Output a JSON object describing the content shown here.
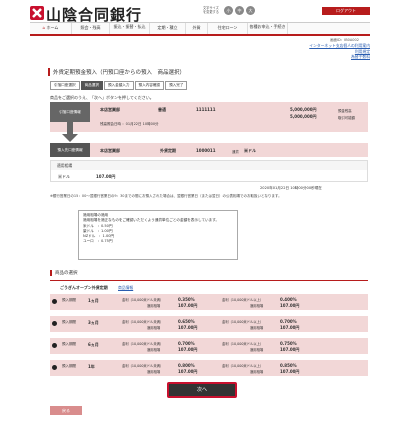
{
  "header": {
    "bank_name": "山陰合同銀行",
    "fontsize_label": "文字サイズを変更する",
    "fontsize_small": "小",
    "fontsize_medium": "中",
    "fontsize_large": "大",
    "logout": "ログアウト"
  },
  "nav": [
    {
      "label": "ホーム",
      "icon": "home-icon"
    },
    {
      "label": "照会・残高"
    },
    {
      "label": "振込・振替・払込"
    },
    {
      "label": "定期・積立"
    },
    {
      "label": "外貨"
    },
    {
      "label": "住宅ローン"
    },
    {
      "label": "各種お申込・手続き"
    }
  ],
  "screen_id": "画面ID：IB0A002",
  "links": [
    "インターネット支店個人の利用案内",
    "利用規定",
    "為替手数料"
  ],
  "page_title": "外貨定期預金預入（円預口座からの預入　商品選択）",
  "steps": [
    "引落口座選択",
    "商品選択",
    "預入金額入力",
    "預入内容確認",
    "預入完了"
  ],
  "active_step": 1,
  "instruction": "商品をご選択のうえ、「次へ」ボタンを押してください。",
  "from": {
    "label": "引落口座情報",
    "branch": "本店営業部",
    "type": "普通",
    "account": "1111111",
    "balance": "5,000,000円",
    "balance_label": "預金残高",
    "available": "5,000,000円",
    "available_label": "取引可能額",
    "inquiry": "残高照会日時 ：01月22日 10時00分"
  },
  "to": {
    "label": "預入先口座情報",
    "branch": "本店営業部",
    "type": "外貨定期",
    "account": "1000011",
    "currency_label": "通貨",
    "currency": "米ドル"
  },
  "rate": {
    "head": "適用相場",
    "currency": "米ドル",
    "value": "107.00円"
  },
  "timestamp": "2020年01月22日 10時00分00秒現在",
  "note": "※銀行営業日の15：00〜翌銀行営業日の9：30までの間にお預入された場合は、翌銀行営業日（または翌日）の公表相場でのお取扱いとなります。",
  "info": {
    "title": "適用相場の適用",
    "desc": "適用相場を適正なものをご確認いただくよう通貨単位ごとの金額を表示しています。",
    "items": [
      "米ドル　：0.50円",
      "豪ドル　：1.00円",
      "NZドル　：1.00円",
      "ユーロ　：0.75円"
    ]
  },
  "section_title": "商品の選択",
  "plan": {
    "title": "ごうぎんオープン外貨定期",
    "link": "商品情報",
    "rows": [
      {
        "term_label": "預入期間",
        "term": "1ヵ月",
        "rate_label_a": "金利（10,000米ドル未満）",
        "rate_a": "0.350%",
        "rate_label_b": "金利（10,000米ドル以上）",
        "rate_b": "0.400%",
        "fx_label": "適用相場",
        "fx_a": "107.00円",
        "fx_b": "107.00円"
      },
      {
        "term_label": "預入期間",
        "term": "3ヵ月",
        "rate_label_a": "金利（10,000米ドル未満）",
        "rate_a": "0.650%",
        "rate_label_b": "金利（10,000米ドル以上）",
        "rate_b": "0.700%",
        "fx_label": "適用相場",
        "fx_a": "107.00円",
        "fx_b": "107.00円"
      },
      {
        "term_label": "預入期間",
        "term": "6ヵ月",
        "rate_label_a": "金利（10,000米ドル未満）",
        "rate_a": "0.700%",
        "rate_label_b": "金利（10,000米ドル以上）",
        "rate_b": "0.750%",
        "fx_label": "適用相場",
        "fx_a": "107.00円",
        "fx_b": "107.00円"
      },
      {
        "term_label": "預入期間",
        "term": "1年",
        "rate_label_a": "金利（10,000米ドル未満）",
        "rate_a": "0.800%",
        "rate_label_b": "金利（10,000米ドル以上）",
        "rate_b": "0.850%",
        "fx_label": "適用相場",
        "fx_a": "107.00円",
        "fx_b": "107.00円"
      }
    ]
  },
  "next_button": "次へ",
  "back_button": "戻る"
}
